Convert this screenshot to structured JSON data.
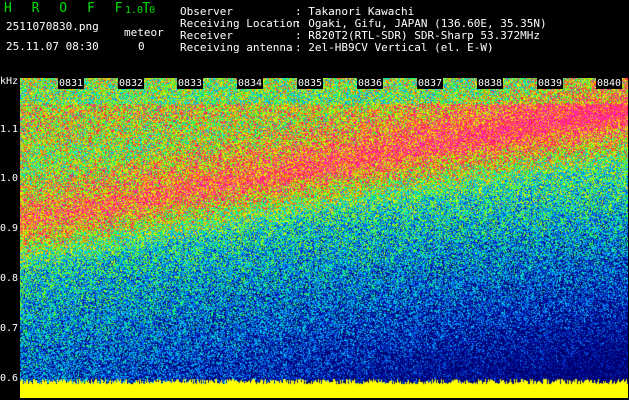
{
  "app": {
    "name": "H R O F F T",
    "version": "1.0.0",
    "filename": "2511070830.png",
    "datetime": "25.11.07 08:30",
    "meteor_label": "meteor",
    "meteor_count": "0"
  },
  "info": {
    "rows": [
      {
        "key": "Observer",
        "value": ": Takanori Kawachi"
      },
      {
        "key": "Receiving Location",
        "value": ": Ogaki, Gifu, JAPAN (136.60E, 35.35N)"
      },
      {
        "key": "Receiver",
        "value": ": R820T2(RTL-SDR) SDR-Sharp 53.372MHz"
      },
      {
        "key": "Receiving antenna",
        "value": ": 2el-HB9CV Vertical (el. E-W)"
      }
    ]
  },
  "axes": {
    "y_unit": "kHz",
    "y_labels": [
      "1.1",
      "1.0",
      "0.9",
      "0.8",
      "0.7",
      "0.6"
    ],
    "x_labels": [
      "0831",
      "0832",
      "0833",
      "0834",
      "0835",
      "0836",
      "0837",
      "0838",
      "0839",
      "0840"
    ]
  },
  "colors": {
    "background": "#000000",
    "baseline": "#ffff00",
    "accent_green": "#00e000",
    "text_cyan": "#40e0ff"
  }
}
